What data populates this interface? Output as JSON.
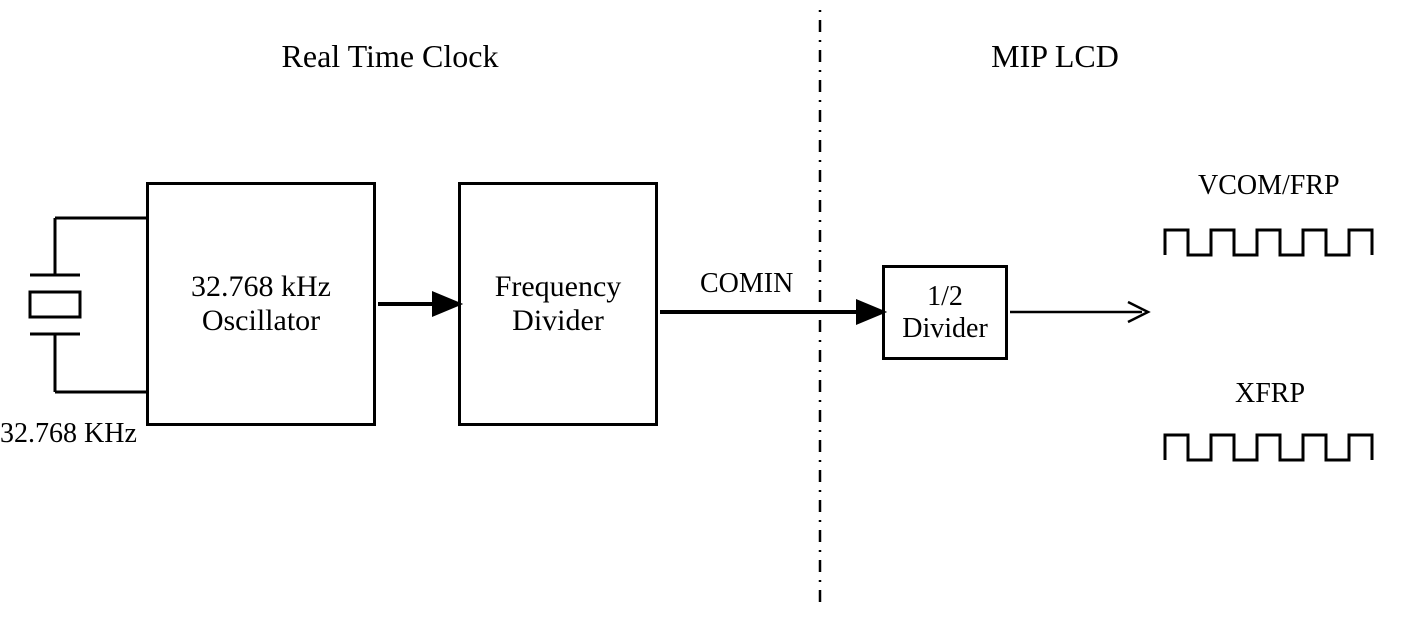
{
  "sections": {
    "left_title": "Real Time Clock",
    "right_title": "MIP LCD"
  },
  "crystal": {
    "freq_label": "32.768 KHz"
  },
  "blocks": {
    "oscillator": {
      "line1": "32.768 kHz",
      "line2": "Oscillator"
    },
    "freq_divider": {
      "line1": "Frequency",
      "line2": "Divider"
    },
    "half_divider": {
      "line1": "1/2",
      "line2": "Divider"
    }
  },
  "signals": {
    "comin": "COMIN"
  },
  "outputs": {
    "vcom_frp": "VCOM/FRP",
    "xfrp": "XFRP"
  }
}
